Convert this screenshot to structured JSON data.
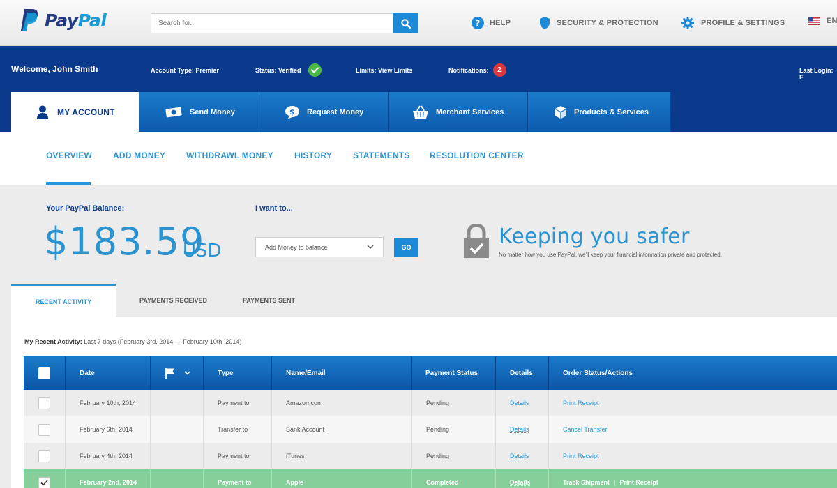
{
  "brand": {
    "pay": "Pay",
    "pal": "Pal"
  },
  "header": {
    "search_placeholder": "Search for...",
    "links": [
      {
        "label": "HELP",
        "icon": "help-icon"
      },
      {
        "label": "SECURITY & PROTECTION",
        "icon": "shield-icon"
      },
      {
        "label": "PROFILE & SETTINGS",
        "icon": "gear-icon"
      },
      {
        "label": "EN",
        "icon": "us-flag-icon"
      }
    ]
  },
  "account_bar": {
    "welcome": "Welcome, John Smith",
    "account_type": "Account Type: Premier",
    "status": "Status: Verified",
    "limits": "Limits: View Limits",
    "notifications_label": "Notifications:",
    "notifications_count": "2",
    "last_login": "Last Login: F"
  },
  "main_tabs": [
    {
      "label": "MY ACCOUNT",
      "icon": "user-icon",
      "active": true
    },
    {
      "label": "Send Money",
      "icon": "money-icon"
    },
    {
      "label": "Request Money",
      "icon": "dollar-bubble-icon"
    },
    {
      "label": "Merchant Services",
      "icon": "basket-icon"
    },
    {
      "label": "Products & Services",
      "icon": "box-icon"
    }
  ],
  "sub_nav": [
    "OVERVIEW",
    "ADD MONEY",
    "WITHDRAWL MONEY",
    "HISTORY",
    "STATEMENTS",
    "RESOLUTION CENTER"
  ],
  "balance": {
    "label": "Your PayPal Balance:",
    "amount": "$183.59",
    "currency": "USD"
  },
  "i_want": {
    "label": "I want to...",
    "selected": "Add Money to balance",
    "go": "GO"
  },
  "safety": {
    "title": "Keeping you safer",
    "subtitle": "No matter how you use PayPal, we'll keep your financial information private and protected."
  },
  "activity_tabs": [
    "RECENT ACTIVITY",
    "PAYMENTS RECEIVED",
    "PAYMENTS SENT"
  ],
  "recent": {
    "label": "My Recent Activity:",
    "range": "Last 7 days (February 3rd, 2014 — February 10th, 2014)"
  },
  "table": {
    "headers": [
      "Date",
      "Type",
      "Name/Email",
      "Payment Status",
      "Details",
      "Order Status/Actions"
    ],
    "rows": [
      {
        "date": "February 10th, 2014",
        "type": "Payment to",
        "name": "Amazon.com",
        "status": "Pending",
        "details": "Details",
        "action": "Print Receipt",
        "action2": "",
        "checked": false
      },
      {
        "date": "February 6th, 2014",
        "type": "Transfer to",
        "name": "Bank Account",
        "status": "Pending",
        "details": "Details",
        "action": "Cancel Transfer",
        "action2": "",
        "checked": false
      },
      {
        "date": "February 4th, 2014",
        "type": "Payment to",
        "name": "iTunes",
        "status": "Pending",
        "details": "Details",
        "action": "Print Receipt",
        "action2": "",
        "checked": false
      },
      {
        "date": "February 2nd, 2014",
        "type": "Payment to",
        "name": "Apple",
        "status": "Completed",
        "details": "Details",
        "action": "Track Shipment",
        "action2": "Print Receipt",
        "checked": true
      }
    ]
  },
  "colors": {
    "navy": "#0b3a8c",
    "accent": "#2a93d0",
    "verified": "#4cb848",
    "alert": "#d9393f",
    "selected_row": "#86cf9b"
  }
}
